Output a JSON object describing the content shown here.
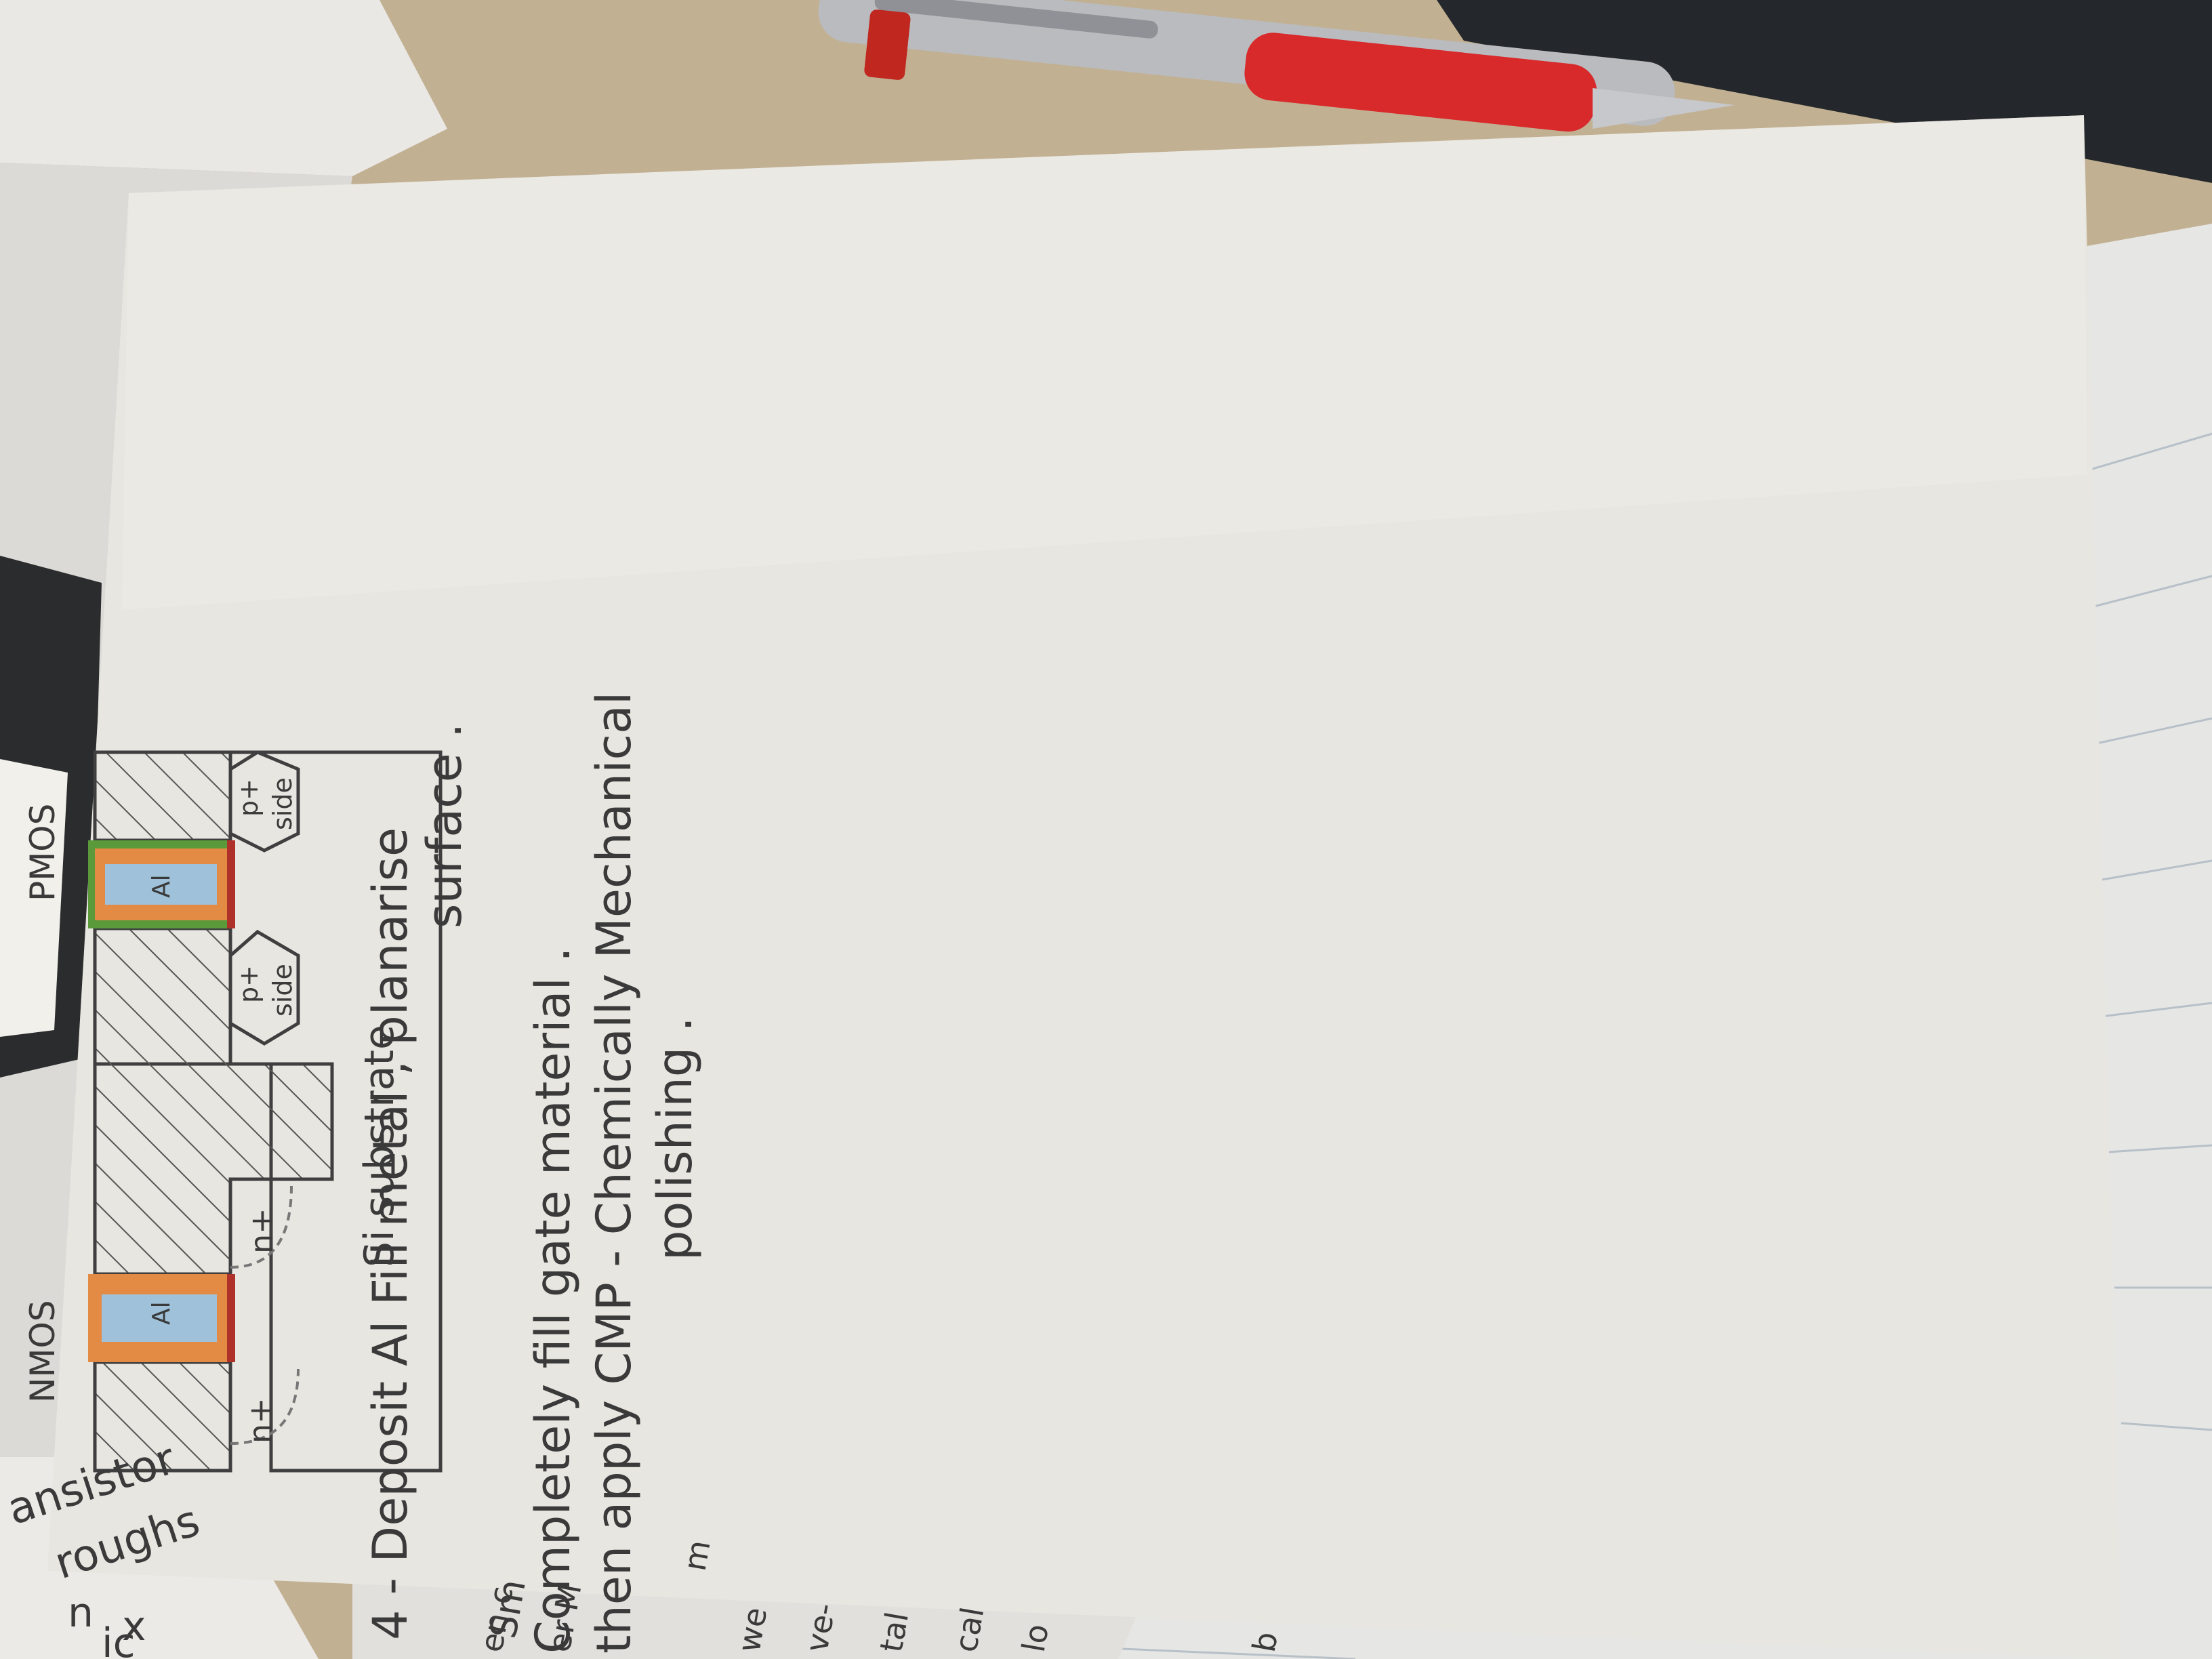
{
  "photo": {
    "description_labels": {
      "heading_nmos": "NMOS",
      "heading_pmos": "PMOS",
      "gate_metal_left": "Al",
      "gate_metal_right": "Al",
      "nplus_left": "n+",
      "nplus_mid": "n+",
      "pplus_side_left_line1": "p+",
      "pplus_side_left_line2": "side",
      "pplus_side_right_line1": "p+",
      "pplus_side_right_line2": "side",
      "substrate": "Si substrate"
    },
    "notes": {
      "line1": "4 - Deposit Al Fill metal , planarise",
      "line2": "surface .",
      "line3": "Completely fill gate material .",
      "line4": "then apply CMP - Chemically Mechanical",
      "line5": "polishing ."
    },
    "background_paper_fragments": {
      "frag1": "ansistor",
      "frag2": "roughs",
      "frag3": "n",
      "frag4": "x",
      "frag5": "ic",
      "frag6": "Sm",
      "frag7": "en c",
      "frag8": "er M",
      "frag9": "we",
      "frag10": "ve-",
      "frag11": "tal",
      "frag12": "cal",
      "frag13": "lo",
      "frag14": "b",
      "frag15": "m"
    }
  },
  "colors": {
    "desk": "#c2b092",
    "paper": "#e7e5df",
    "pen_red": "#d8292b",
    "pen_silver": "#b9bbbf",
    "pencil_ink": "#3f3f3f",
    "gate_blue": "#9fc2da",
    "gate_orange": "#e38b45",
    "gate_green": "#5a9a3a",
    "gate_red": "#b0302a"
  }
}
